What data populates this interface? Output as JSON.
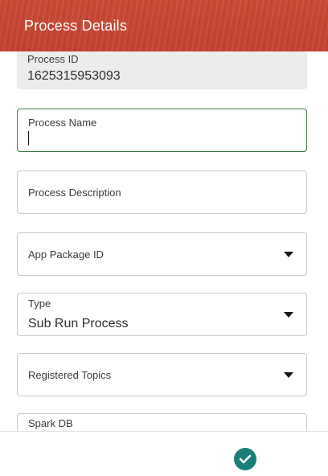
{
  "header": {
    "title": "Process Details"
  },
  "form": {
    "process_id": {
      "label": "Process ID",
      "value": "1625315953093"
    },
    "process_name": {
      "label": "Process Name",
      "value": ""
    },
    "process_description": {
      "label": "Process Description"
    },
    "app_package_id": {
      "label": "App Package ID"
    },
    "type": {
      "label": "Type",
      "value": "Sub Run Process"
    },
    "registered_topics": {
      "label": "Registered Topics"
    },
    "spark_db": {
      "label": "Spark DB"
    }
  },
  "footer": {
    "confirm_icon": "check-icon",
    "accent_color": "#1b7f79"
  },
  "colors": {
    "header_bg": "#c74634",
    "focus_border": "#3a7d3f"
  }
}
